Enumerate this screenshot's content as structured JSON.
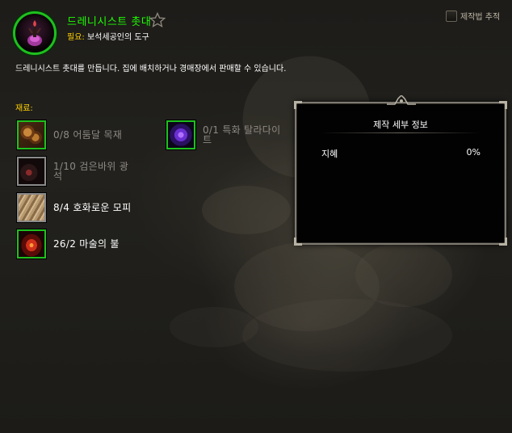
{
  "recipe": {
    "title": "드레니시스트 촛대",
    "requires_label": "필요:",
    "requires_value": "보석세공인의 도구",
    "description": "드레니시스트 촛대를 만듭니다. 집에 배치하거나 경매장에서 판매할 수 있습니다.",
    "icon": "candle-icon",
    "favorite_icon": "star-outline-icon"
  },
  "track": {
    "label": "제작법 추적",
    "checked": false
  },
  "reagents": {
    "label": "재료:",
    "items": [
      {
        "text": "0/8 어둠달 목재",
        "icon": "lumber-icon",
        "sufficient": false
      },
      {
        "text": "1/10 검은바위 광석",
        "icon": "ore-icon",
        "sufficient": false
      },
      {
        "text": "8/4 호화로운 모피",
        "icon": "fur-icon",
        "sufficient": true
      },
      {
        "text": "26/2 마술의 불",
        "icon": "fire-icon",
        "sufficient": true
      },
      {
        "text": "0/1 특화 탈라다이트",
        "icon": "talador-gem-icon",
        "sufficient": false
      }
    ]
  },
  "details": {
    "title": "제작 세부 정보",
    "stat_label": "지혜",
    "stat_value": "0%"
  },
  "colors": {
    "title_green": "#1eff00",
    "label_gold": "#ffd100",
    "quality_border": "#1ec01e"
  }
}
